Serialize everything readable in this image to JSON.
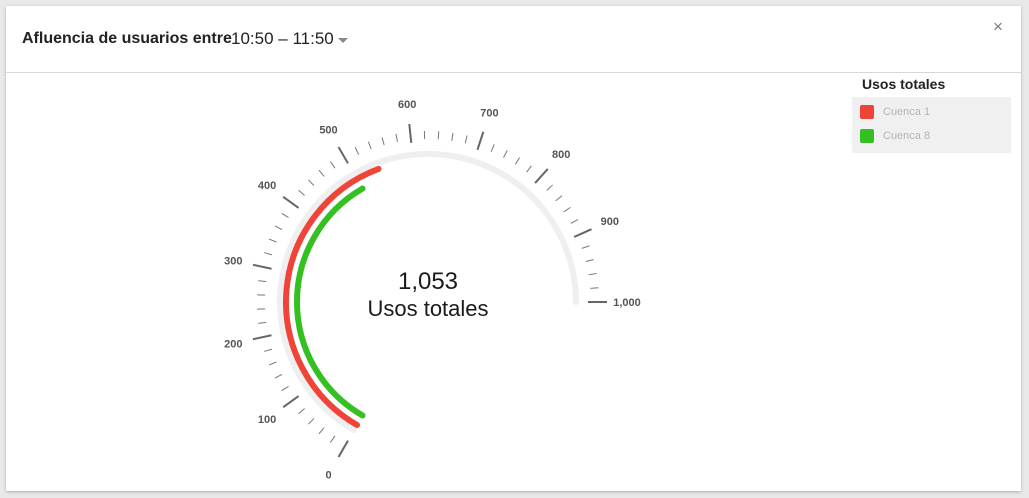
{
  "header": {
    "title": "Afluencia de usuarios entre",
    "time_range": "10:50 – 11:50",
    "close_symbol": "×"
  },
  "legend": {
    "title": "Usos totales",
    "items": [
      {
        "label": "Cuenca 1",
        "color": "#f04438"
      },
      {
        "label": "Cuenca 8",
        "color": "#34c021"
      }
    ]
  },
  "chart_data": {
    "type": "gauge",
    "min": 0,
    "max": 1000,
    "major_ticks": [
      0,
      100,
      200,
      300,
      400,
      500,
      600,
      700,
      800,
      900,
      1000
    ],
    "tick_labels": [
      "0",
      "100",
      "200",
      "300",
      "400",
      "500",
      "600",
      "700",
      "800",
      "900",
      "1,000"
    ],
    "minor_divisions": 5,
    "center_value": "1,053",
    "center_label": "Usos totales",
    "series": [
      {
        "name": "Cuenca 1",
        "value": 540,
        "color": "#f04438"
      },
      {
        "name": "Cuenca 8",
        "value": 500,
        "color": "#34c021"
      }
    ],
    "track_color": "#efefef"
  }
}
